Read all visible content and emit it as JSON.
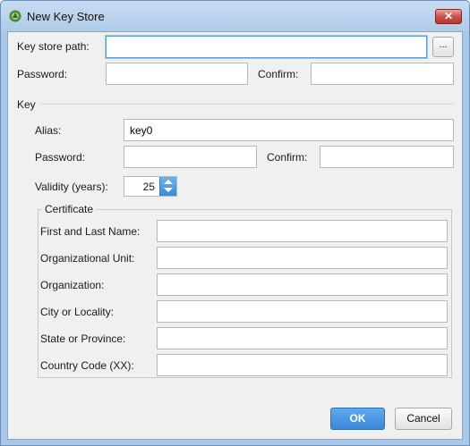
{
  "window": {
    "title": "New Key Store",
    "close_glyph": "✕"
  },
  "keystore": {
    "path_label": "Key store path:",
    "path_value": "",
    "browse_label": "...",
    "password_label": "Password:",
    "confirm_label": "Confirm:"
  },
  "key": {
    "section_label": "Key",
    "alias_label": "Alias:",
    "alias_value": "key0",
    "password_label": "Password:",
    "confirm_label": "Confirm:",
    "validity_label": "Validity (years):",
    "validity_value": "25"
  },
  "certificate": {
    "legend": "Certificate",
    "first_last_label": "First and Last Name:",
    "org_unit_label": "Organizational Unit:",
    "org_label": "Organization:",
    "city_label": "City or Locality:",
    "state_label": "State or Province:",
    "country_label": "Country Code (XX):"
  },
  "buttons": {
    "ok": "OK",
    "cancel": "Cancel"
  },
  "colors": {
    "accent": "#3b87d7",
    "title_bar": "#aecbe8",
    "close_button": "#c75050"
  }
}
